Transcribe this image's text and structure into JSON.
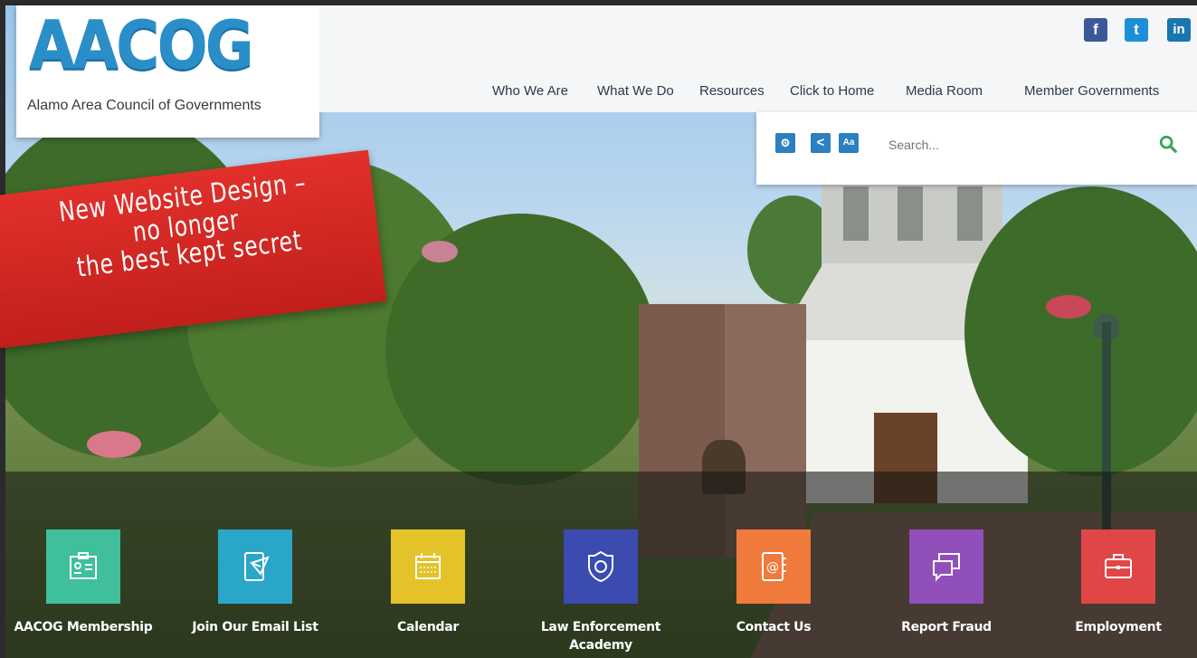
{
  "header": {
    "logo_text": "AACOG",
    "logo_subtitle": "Alamo Area Council of Governments"
  },
  "social": [
    {
      "name": "facebook-icon",
      "glyph": "f",
      "color": "#3b5998"
    },
    {
      "name": "twitter-icon",
      "glyph": "t",
      "color": "#1d8fd8"
    },
    {
      "name": "linkedin-icon",
      "glyph": "in",
      "color": "#1976b0"
    }
  ],
  "nav": {
    "items": [
      "Who We Are",
      "What We Do",
      "Resources",
      "Click to Home",
      "Media Room",
      "Member Governments"
    ]
  },
  "tools": {
    "settings_glyph": "⚙",
    "share_glyph": "<",
    "text_size_label": "Aa",
    "search_placeholder": "Search..."
  },
  "banner": {
    "text": "New Website Design –\nno longer\nthe best kept secret"
  },
  "quick_links": [
    {
      "label": "AACOG Membership",
      "color": "#3fbf9c",
      "icon": "id-card-icon"
    },
    {
      "label": "Join Our Email List",
      "color": "#2aa6c9",
      "icon": "email-form-icon"
    },
    {
      "label": "Calendar",
      "color": "#e4c22a",
      "icon": "calendar-icon"
    },
    {
      "label": "Law Enforcement\nAcademy",
      "color": "#3b4bb0",
      "icon": "police-badge-icon"
    },
    {
      "label": "Contact Us",
      "color": "#ef7a3c",
      "icon": "address-book-icon"
    },
    {
      "label": "Report Fraud",
      "color": "#9150b9",
      "icon": "speech-bubbles-icon"
    },
    {
      "label": "Employment",
      "color": "#e14646",
      "icon": "briefcase-icon"
    }
  ]
}
